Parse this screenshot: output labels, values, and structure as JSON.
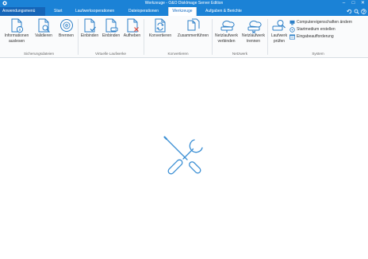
{
  "window": {
    "title": "Werkzeuge - O&O DiskImage Server Edition",
    "minimize": "–",
    "maximize": "□",
    "close": "✕"
  },
  "tabs": [
    {
      "label": "Anwendungsmenü"
    },
    {
      "label": "Start"
    },
    {
      "label": "Laufwerksoperationen"
    },
    {
      "label": "Dateioperationen"
    },
    {
      "label": "Werkzeuge",
      "active": true
    },
    {
      "label": "Aufgaben & Berichte"
    }
  ],
  "ribbon": {
    "sicherung": {
      "label": "Sicherungsdateien",
      "buttons": [
        {
          "line1": "Informationen",
          "line2": "auslesen",
          "icon": "file-info-icon"
        },
        {
          "line1": "Validieren",
          "line2": "",
          "icon": "file-search-icon"
        },
        {
          "line1": "Brennen",
          "line2": "",
          "icon": "disc-icon"
        }
      ]
    },
    "virtuell": {
      "label": "Virtuelle Laufwerke",
      "buttons": [
        {
          "line1": "Einbinden",
          "line2": "",
          "icon": "mount-icon"
        },
        {
          "line1": "Einbinden",
          "line2": "",
          "icon": "mount-drive-icon"
        },
        {
          "line1": "Aufheben",
          "line2": "",
          "icon": "unmount-icon"
        }
      ]
    },
    "konvertieren": {
      "label": "Konvertieren",
      "buttons": [
        {
          "line1": "Konvertieren",
          "line2": "",
          "icon": "convert-icon"
        },
        {
          "line1": "Zusammenführen",
          "line2": "",
          "icon": "merge-icon"
        }
      ]
    },
    "netzwerk": {
      "label": "Netzwerk",
      "buttons": [
        {
          "line1": "Netzlaufwerk",
          "line2": "verbinden",
          "icon": "network-connect-icon"
        },
        {
          "line1": "Netzlaufwerk",
          "line2": "trennen",
          "icon": "network-disconnect-icon"
        }
      ]
    },
    "system": {
      "label": "System",
      "buttons": [
        {
          "line1": "Laufwerk",
          "line2": "prüfen",
          "icon": "drive-check-icon"
        }
      ],
      "small_buttons": [
        {
          "label": "Computereigenschaften ändern",
          "icon": "computer-properties-icon"
        },
        {
          "label": "Startmedium erstellen",
          "icon": "boot-media-icon"
        },
        {
          "label": "Eingabeaufforderung",
          "icon": "command-prompt-icon"
        }
      ]
    }
  },
  "colors": {
    "titlebar": "#1b82d6",
    "accent": "#1b6ec2",
    "icon_blue": "#2c7fc7",
    "remove_red": "#e04a3c"
  },
  "main": {
    "illustration": "tools-icon"
  }
}
